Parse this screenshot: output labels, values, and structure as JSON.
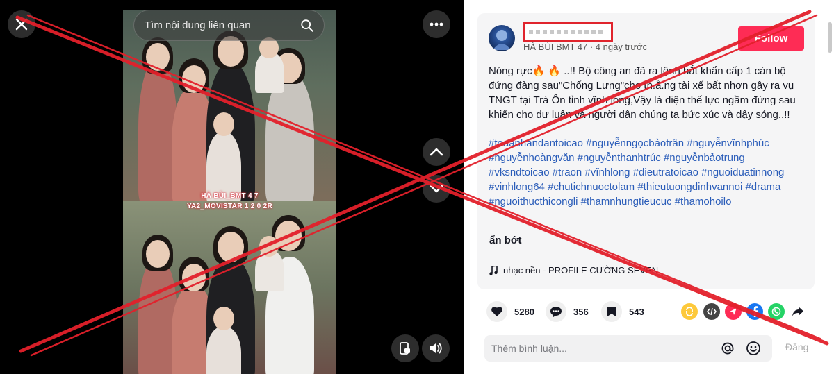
{
  "search": {
    "placeholder": "Tìm nội dung liên quan"
  },
  "video": {
    "watermark_line1": "HÀ BÙI_BMT 4 7",
    "watermark_line2": "YA2_MOVISTAR 1 2 0 2R"
  },
  "post": {
    "username_redacted": true,
    "meta": "HÀ BÙI BMT 47 · 4 ngày trước",
    "follow_label": "Follow",
    "description": "Nóng rực🔥 🔥 ..!! Bộ công an đã ra lệnh bắt khẩn cấp 1 cán bộ đứng đàng sau\"Chống Lưng\"cho th.ằ.ng tài xế bất nhơn gây ra vụ TNGT tại Trà Ôn tỉnh vĩnh long,Vậy là diện thế lực ngầm đứng sau khiến cho dư luận và người dân chúng ta bức xúc và dậy sóng..!!",
    "hashtags": [
      "#toaanhandantoicao",
      "#nguyễnngọcbảotrân",
      "#nguyễnvĩnhphúc",
      "#nguyễnhoàngvăn",
      "#nguyễnthanhtrúc",
      "#nguyễnbảotrung",
      "#vksndtoicao",
      "#traon",
      "#vĩnhlong",
      "#dieutratoicao",
      "#nguoiduatinnong",
      "#vinhlong64",
      "#chutichnuoctolam",
      "#thieutuongdinhvannoi",
      "#drama",
      "#nguoithucthicongli",
      "#thamnhungtieucuc",
      "#thamohoilo"
    ],
    "less_label": "ẩn bớt",
    "music": "nhạc nền - PROFILE CƯỜNG SEVEN"
  },
  "actions": {
    "likes": "5280",
    "comments": "356",
    "saves": "543"
  },
  "comment": {
    "placeholder": "Thêm bình luận...",
    "post_label": "Đăng"
  },
  "icons": {
    "close": "close-icon",
    "more": "more-icon",
    "up": "chevron-up-icon",
    "down": "chevron-down-icon",
    "pip": "picture-in-picture-icon",
    "volume": "volume-icon",
    "search": "search-icon",
    "music": "music-note-icon",
    "like": "heart-icon",
    "comment": "comment-icon",
    "save": "bookmark-icon",
    "repost": "repost-icon",
    "embed": "embed-icon",
    "friends": "send-to-friends-icon",
    "facebook": "facebook-icon",
    "whatsapp": "whatsapp-icon",
    "share": "share-arrow-icon",
    "mention": "mention-icon",
    "emoji": "emoji-icon"
  },
  "colors": {
    "follow": "#fe2c55",
    "hashtag": "#2b5db9",
    "overlay_x": "#e3202b"
  }
}
